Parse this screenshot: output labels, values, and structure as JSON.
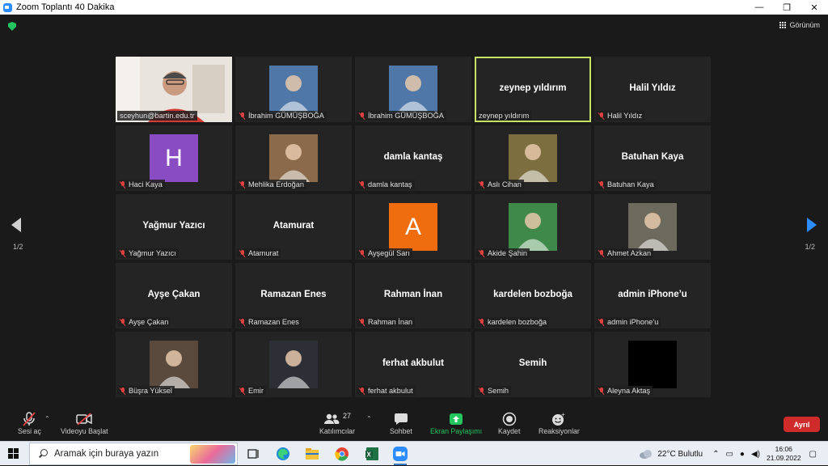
{
  "window": {
    "title": "Zoom Toplantı 40 Dakika"
  },
  "view_button": {
    "label": "Görünüm"
  },
  "pagination": {
    "left": "1/2",
    "right": "1/2"
  },
  "participants": [
    {
      "label": "sceyhun@bartin.edu.tr",
      "display": "",
      "type": "video",
      "muted": false,
      "speaking": false
    },
    {
      "label": "İbrahim GÜMÜŞBOĞA",
      "display": "",
      "type": "photo",
      "photo_color": "#4f78a8",
      "muted": true,
      "speaking": false
    },
    {
      "label": "İbrahim GÜMÜŞBOĞA",
      "display": "",
      "type": "photo",
      "photo_color": "#4f78a8",
      "muted": true,
      "speaking": false
    },
    {
      "label": "zeynep yıldırım",
      "display": "zeynep yıldırım",
      "type": "name",
      "muted": false,
      "speaking": true
    },
    {
      "label": "Halil Yıldız",
      "display": "Halil Yıldız",
      "type": "name",
      "muted": true,
      "speaking": false
    },
    {
      "label": "Haci Kaya",
      "display": "H",
      "type": "letter",
      "letter_color": "#8a4cc2",
      "muted": true,
      "speaking": false
    },
    {
      "label": "Mehlika Erdoğan",
      "display": "",
      "type": "photo",
      "photo_color": "#8a6a4a",
      "muted": true,
      "speaking": false
    },
    {
      "label": "damla kantaş",
      "display": "damla kantaş",
      "type": "name",
      "muted": true,
      "speaking": false
    },
    {
      "label": "Aslı Cihan",
      "display": "",
      "type": "photo",
      "photo_color": "#7c6e3f",
      "muted": true,
      "speaking": false
    },
    {
      "label": "Batuhan Kaya",
      "display": "Batuhan Kaya",
      "type": "name",
      "muted": true,
      "speaking": false
    },
    {
      "label": "Yağmur Yazıcı",
      "display": "Yağmur Yazıcı",
      "type": "name",
      "muted": true,
      "speaking": false
    },
    {
      "label": "Atamurat",
      "display": "Atamurat",
      "type": "name",
      "muted": true,
      "speaking": false
    },
    {
      "label": "Ayşegül Sarı",
      "display": "A",
      "type": "letter",
      "letter_color": "#ef6c0f",
      "muted": true,
      "speaking": false
    },
    {
      "label": "Akide Şahin",
      "display": "",
      "type": "photo",
      "photo_color": "#3f8a4a",
      "muted": true,
      "speaking": false
    },
    {
      "label": "Ahmet Azkan",
      "display": "",
      "type": "photo",
      "photo_color": "#6b6a5c",
      "muted": true,
      "speaking": false
    },
    {
      "label": "Ayşe Çakan",
      "display": "Ayşe Çakan",
      "type": "name",
      "muted": true,
      "speaking": false
    },
    {
      "label": "Ramazan Enes",
      "display": "Ramazan Enes",
      "type": "name",
      "muted": true,
      "speaking": false
    },
    {
      "label": "Rahman İnan",
      "display": "Rahman İnan",
      "type": "name",
      "muted": true,
      "speaking": false
    },
    {
      "label": "kardelen bozboğa",
      "display": "kardelen bozboğa",
      "type": "name",
      "muted": true,
      "speaking": false
    },
    {
      "label": "admin iPhone’u",
      "display": "admin iPhone’u",
      "type": "name",
      "muted": true,
      "speaking": false
    },
    {
      "label": "Büşra Yüksel",
      "display": "",
      "type": "photo",
      "photo_color": "#5a4a3e",
      "muted": true,
      "speaking": false
    },
    {
      "label": "Emir",
      "display": "",
      "type": "photo",
      "photo_color": "#2e2f36",
      "muted": true,
      "speaking": false
    },
    {
      "label": "ferhat akbulut",
      "display": "ferhat akbulut",
      "type": "name",
      "muted": true,
      "speaking": false
    },
    {
      "label": "Semih",
      "display": "Semih",
      "type": "name",
      "muted": true,
      "speaking": false
    },
    {
      "label": "Aleyna Aktaş",
      "display": "",
      "type": "photo",
      "photo_color": "#000000",
      "muted": true,
      "speaking": false
    }
  ],
  "toolbar": {
    "mic_label": "Sesi aç",
    "video_label": "Videoyu Başlat",
    "participants_label": "Katılımcılar",
    "participants_count": "27",
    "chat_label": "Sohbet",
    "share_label": "Ekran Paylaşımı",
    "record_label": "Kaydet",
    "reactions_label": "Reaksiyonlar",
    "leave_label": "Ayrıl"
  },
  "taskbar": {
    "search_placeholder": "Aramak için buraya yazın",
    "weather": "22°C  Bulutlu",
    "time": "16:06",
    "date": "21.09.2022"
  },
  "colors": {
    "share_green": "#22c55e",
    "leave_red": "#d02b2b",
    "active_speaker": "#c9e265",
    "accent_blue": "#2d8cff"
  }
}
